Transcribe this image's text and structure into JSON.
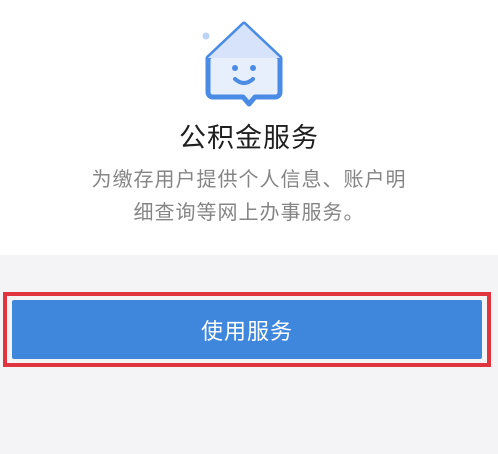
{
  "service": {
    "icon": "house-smile-icon",
    "title": "公积金服务",
    "description_line1": "为缴存用户提供个人信息、账户明",
    "description_line2": "细查询等网上办事服务。"
  },
  "actions": {
    "use_service_label": "使用服务"
  },
  "colors": {
    "primary": "#3f86dd",
    "highlight_border": "#e0353f",
    "icon_blue": "#4a8be6",
    "icon_fill": "#e7eefc",
    "background": "#f4f4f6"
  }
}
